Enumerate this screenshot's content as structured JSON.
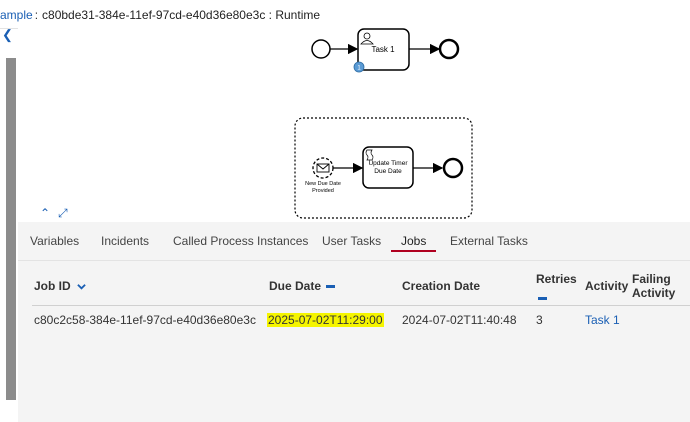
{
  "header": {
    "crumb_link": "ample",
    "crumb_separator": ":",
    "instance_id": "c80bde31-384e-11ef-97cd-e40d36e80e3c",
    "view_name": ": Runtime"
  },
  "diagram": {
    "task1_label": "Task 1",
    "task1_badge": "1",
    "event_label_line1": "New Due Date",
    "event_label_line2": "Provided",
    "update_task_line1": "Update Timer",
    "update_task_line2": "Due Date"
  },
  "tabs": [
    {
      "label": "Variables"
    },
    {
      "label": "Incidents"
    },
    {
      "label": "Called Process Instances"
    },
    {
      "label": "User Tasks"
    },
    {
      "label": "Jobs"
    },
    {
      "label": "External Tasks"
    }
  ],
  "active_tab": "Jobs",
  "table": {
    "columns": [
      "Job ID",
      "Due Date",
      "Creation Date",
      "Retries",
      "Activity",
      "Failing Activity"
    ],
    "rows": [
      {
        "job_id": "c80c2c58-384e-11ef-97cd-e40d36e80e3c",
        "due_date": "2025-07-02T11:29:00",
        "creation_date": "2024-07-02T11:40:48",
        "retries": "3",
        "activity": "Task 1",
        "failing_activity": ""
      }
    ]
  },
  "colors": {
    "link": "#1a5fb4",
    "tab_underline": "#b00020",
    "highlight": "#f5f500"
  }
}
